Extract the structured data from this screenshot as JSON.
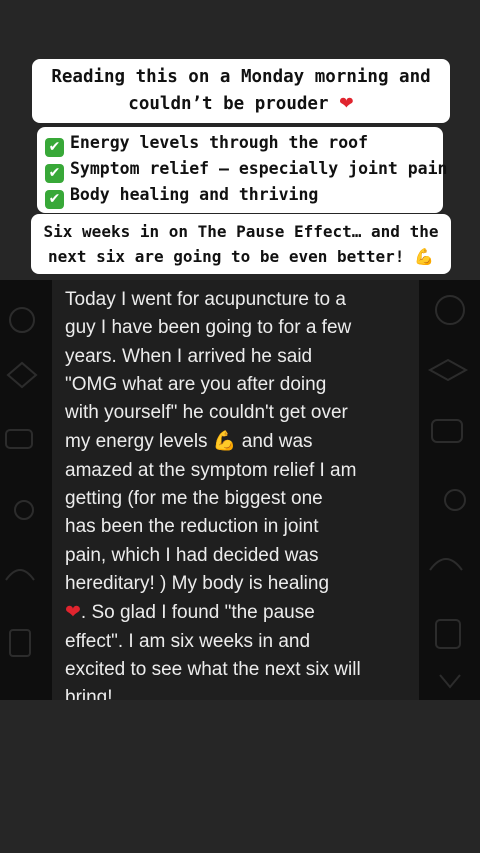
{
  "colors": {
    "background": "#262626",
    "caption_bg": "#ffffff",
    "check": "#38a838",
    "heart": "#e0242e",
    "chat_bg": "#0e0e0e",
    "bubble_bg": "#1f1f1f",
    "bubble_text": "#ececec"
  },
  "captions": {
    "headline": {
      "line1": "Reading this on a Monday morning and",
      "line2": "couldn’t be prouder",
      "icon": "red-heart-icon"
    },
    "checklist": [
      {
        "icon": "check-mark-icon",
        "text": "Energy levels through the roof"
      },
      {
        "icon": "check-mark-icon",
        "text": "Symptom relief — especially joint pain"
      },
      {
        "icon": "check-mark-icon",
        "text": "Body healing and thriving"
      }
    ],
    "closing": {
      "line1": "Six weeks in on The Pause Effect… and the",
      "line2": "next six are going to be even better!",
      "icon": "flexed-biceps-icon"
    }
  },
  "message": {
    "lines": [
      "Today I went for acupuncture to a",
      "guy I have been going to for a few",
      "years.  When I arrived he said",
      "\"OMG what are you after doing",
      "with yourself\" he couldn't get over",
      "my energy levels",
      " and was",
      "amazed at the symptom relief I am",
      "getting (for me the biggest one",
      "has been the reduction in joint",
      "pain, which I had decided was",
      "hereditary! ) My body is healing",
      ". So glad I found \"the pause",
      "effect\". I am six weeks in and",
      "excited to see what the next six will",
      "bring!"
    ],
    "icons": [
      "flexed-biceps-icon",
      "red-heart-icon"
    ]
  }
}
